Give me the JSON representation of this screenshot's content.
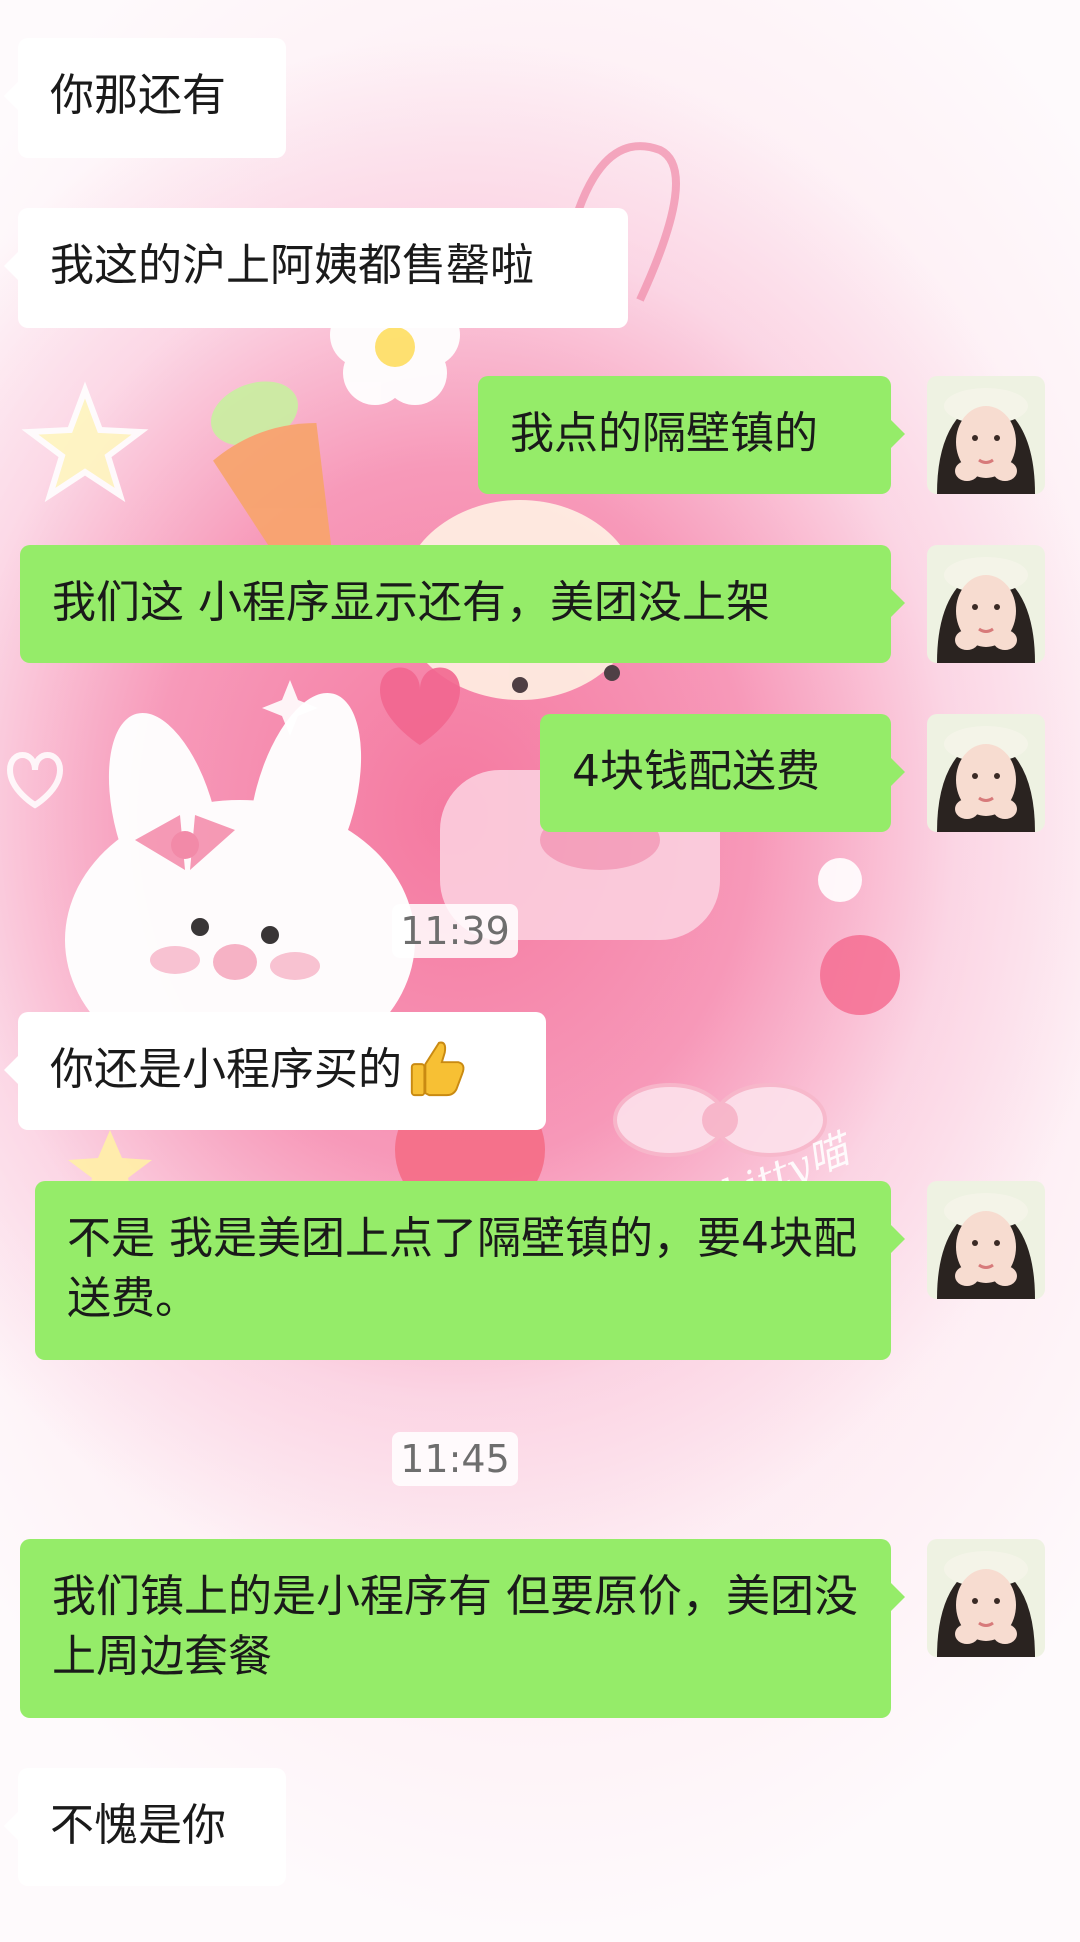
{
  "messages": [
    {
      "side": "in",
      "text": "你那还有"
    },
    {
      "side": "in",
      "text": "我这的沪上阿姨都售罄啦"
    },
    {
      "side": "out",
      "text": "我点的隔壁镇的"
    },
    {
      "side": "out",
      "text": "我们这 小程序显示还有，美团没上架"
    },
    {
      "side": "out",
      "text": "4块钱配送费"
    },
    {
      "type": "time",
      "text": "11:39"
    },
    {
      "side": "in",
      "text": "你还是小程序买的",
      "emoji": "thumbs-up"
    },
    {
      "side": "out",
      "text": "不是 我是美团上点了隔壁镇的，要4块配送费。"
    },
    {
      "type": "time",
      "text": "11:45"
    },
    {
      "side": "out",
      "text": "我们镇上的是小程序有 但要原价，美团没上周边套餐"
    },
    {
      "side": "in",
      "text": "不愧是你"
    }
  ],
  "wallpaper": {
    "watermark": "kitty喵"
  },
  "colors": {
    "outgoing_bubble": "#95ec69",
    "incoming_bubble": "#ffffff",
    "timestamp_text": "#6e6e6e"
  },
  "icons": {
    "reaction_emoji": "thumbs-up-icon",
    "avatar": "user-avatar"
  }
}
